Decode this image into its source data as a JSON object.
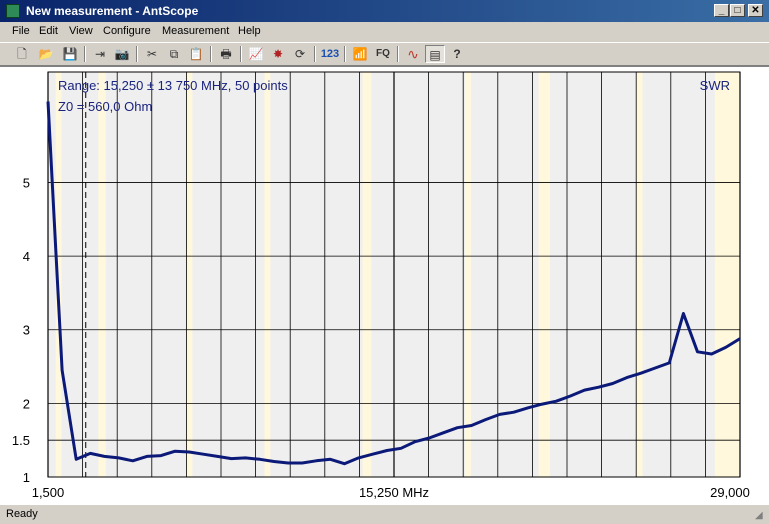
{
  "window": {
    "title": "New measurement - AntScope",
    "icon": "antscope-app-icon",
    "buttons": {
      "minimize": "_",
      "maximize": "□",
      "close": "✕"
    }
  },
  "menu": [
    "File",
    "Edit",
    "View",
    "Configure",
    "Measurement",
    "Help"
  ],
  "toolbar": {
    "new_icon": "new-file-icon",
    "new_glyph": "🗋",
    "open_icon": "open-folder-icon",
    "open_glyph": "📂",
    "save_icon": "save-icon",
    "save_glyph": "💾",
    "export_icon": "export-icon",
    "export_glyph": "⇥",
    "camera_icon": "camera-icon",
    "camera_glyph": "📷",
    "cut_icon": "cut-icon",
    "cut_glyph": "✂",
    "copy_icon": "copy-icon",
    "copy_glyph": "⧉",
    "paste_icon": "paste-icon",
    "paste_glyph": "📋",
    "print_icon": "print-icon",
    "print_glyph": "🖶",
    "chart_icon": "chart-icon",
    "chart_glyph": "📈",
    "star_icon": "star-burst-icon",
    "star_glyph": "✸",
    "refresh_icon": "refresh-icon",
    "refresh_glyph": "⟳",
    "numbers_label": "123",
    "antenna_icon": "antenna-icon",
    "antenna_glyph": "📶",
    "fq_label": "FQ",
    "waves_icon": "waves-icon",
    "waves_glyph": "∿",
    "notes_icon": "notes-icon",
    "notes_glyph": "▤",
    "help_icon": "help-icon",
    "help_glyph": "?"
  },
  "status": {
    "text": "Ready"
  },
  "colors": {
    "plot_line": "#0b1a78",
    "plot_bg": "#efefef",
    "band_fill": "#fff8dc",
    "grid": "#000000",
    "annotation_text": "#1a237e"
  },
  "chart_data": {
    "type": "line",
    "title": "",
    "annotation_range": "Range: 15,250 ± 13 750 MHz, 50 points",
    "annotation_z0": "Z0 = 560,0 Ohm",
    "series_label": "SWR",
    "x": [
      1.5,
      2.06,
      2.62,
      3.18,
      3.74,
      4.31,
      4.87,
      5.43,
      5.99,
      6.55,
      7.11,
      7.67,
      8.23,
      8.79,
      9.35,
      9.92,
      10.48,
      11.04,
      11.6,
      12.16,
      12.72,
      13.28,
      13.84,
      14.4,
      14.97,
      15.53,
      16.09,
      16.65,
      17.21,
      17.77,
      18.33,
      18.89,
      19.45,
      20.01,
      20.58,
      21.14,
      21.7,
      22.26,
      22.82,
      23.38,
      23.94,
      24.5,
      25.06,
      25.63,
      26.19,
      26.75,
      27.31,
      27.87,
      28.43,
      29.0
    ],
    "y": [
      6.1,
      2.45,
      1.24,
      1.32,
      1.28,
      1.26,
      1.22,
      1.28,
      1.29,
      1.35,
      1.34,
      1.31,
      1.28,
      1.25,
      1.26,
      1.24,
      1.21,
      1.19,
      1.19,
      1.22,
      1.24,
      1.18,
      1.26,
      1.31,
      1.36,
      1.39,
      1.48,
      1.53,
      1.6,
      1.67,
      1.7,
      1.78,
      1.85,
      1.88,
      1.94,
      1.99,
      2.03,
      2.1,
      2.18,
      2.22,
      2.27,
      2.35,
      2.41,
      2.48,
      2.55,
      3.22,
      2.7,
      2.67,
      2.76,
      2.88
    ],
    "xlim": [
      1.5,
      29.0
    ],
    "ylim": [
      1,
      6.5
    ],
    "y_ticks": [
      1,
      1.5,
      2,
      3,
      4,
      5
    ],
    "y_tick_labels": [
      "1",
      "1.5",
      "2",
      "3",
      "4",
      "5"
    ],
    "x_tick_labels": [
      "1,500",
      "15,250 MHz",
      "29,000"
    ],
    "highlight_bands": [
      [
        1.8,
        2.0
      ],
      [
        3.5,
        3.8
      ],
      [
        7.0,
        7.2
      ],
      [
        10.1,
        10.15
      ],
      [
        14.0,
        14.35
      ],
      [
        18.068,
        18.168
      ],
      [
        21.0,
        21.45
      ],
      [
        24.89,
        24.99
      ],
      [
        28.0,
        29.0
      ]
    ],
    "marker_x": 3.0,
    "grid": true
  }
}
